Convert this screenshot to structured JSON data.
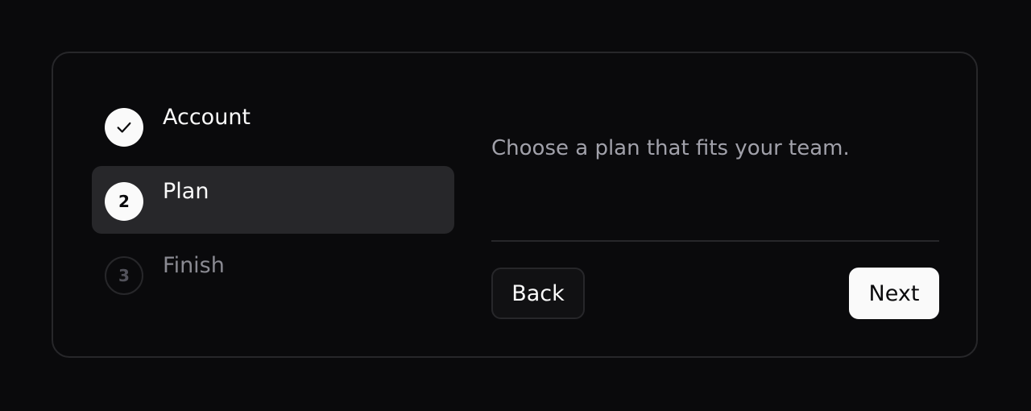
{
  "wizard": {
    "steps": [
      {
        "number": "1",
        "label": "Account",
        "status": "completed",
        "icon": "check-icon"
      },
      {
        "number": "2",
        "label": "Plan",
        "status": "current"
      },
      {
        "number": "3",
        "label": "Finish",
        "status": "upcoming"
      }
    ],
    "description": "Choose a plan that fits your team.",
    "back_label": "Back",
    "next_label": "Next"
  },
  "colors": {
    "background": "#0a0a0c",
    "card_border": "#27272a",
    "active_step_bg": "#27272a",
    "text_primary": "#fafafa",
    "text_muted": "#a1a1aa",
    "text_disabled": "#8a8a92"
  }
}
